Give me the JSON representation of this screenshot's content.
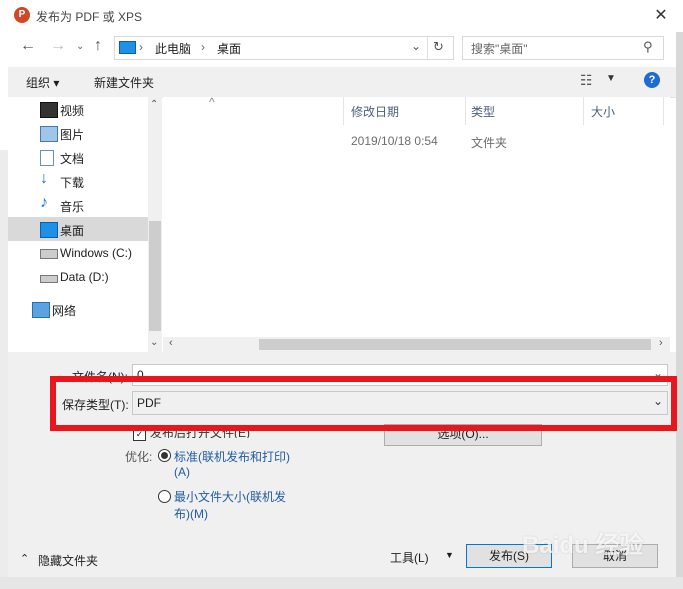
{
  "window": {
    "title": "发布为 PDF 或 XPS"
  },
  "navigation": {
    "path": [
      "此电脑",
      "桌面"
    ],
    "search_placeholder": "搜索\"桌面\""
  },
  "toolbar": {
    "organize_label": "组织 ▾",
    "new_folder_label": "新建文件夹",
    "help_label": "?"
  },
  "nav_pane": {
    "items": [
      {
        "label": "视频",
        "icon": "video-icon"
      },
      {
        "label": "图片",
        "icon": "picture-icon"
      },
      {
        "label": "文档",
        "icon": "document-icon"
      },
      {
        "label": "下载",
        "icon": "download-icon"
      },
      {
        "label": "音乐",
        "icon": "music-icon"
      },
      {
        "label": "桌面",
        "icon": "desktop-icon",
        "selected": true
      },
      {
        "label": "Windows (C:)",
        "icon": "drive-c-icon"
      },
      {
        "label": "Data (D:)",
        "icon": "drive-d-icon"
      },
      {
        "label": "网络",
        "icon": "network-icon"
      }
    ]
  },
  "file_list": {
    "columns": [
      "修改日期",
      "类型",
      "大小"
    ],
    "rows": [
      {
        "date": "2019/10/18 0:54",
        "type": "文件夹"
      }
    ]
  },
  "form": {
    "filename_label": "文件名(N):",
    "filename_value": "0",
    "savetype_label": "保存类型(T):",
    "savetype_value": "PDF",
    "open_after_label": "发布后打开文件(E)",
    "options_label": "选项(O)...",
    "optimize_label": "优化:",
    "opt_standard_line1": "标准(联机发布和打印)",
    "opt_standard_line2": "(A)",
    "opt_min_line1": "最小文件大小(联机发",
    "opt_min_line2": "布)(M)"
  },
  "footer": {
    "hide_folders_label": "隐藏文件夹",
    "tools_label": "工具(L)",
    "publish_label": "发布(S)",
    "cancel_label": "取消"
  },
  "watermark": "Baidu 经验",
  "colors": {
    "highlight": "#e8171d",
    "selection": "#cce8ff",
    "accent": "#0078d7"
  }
}
